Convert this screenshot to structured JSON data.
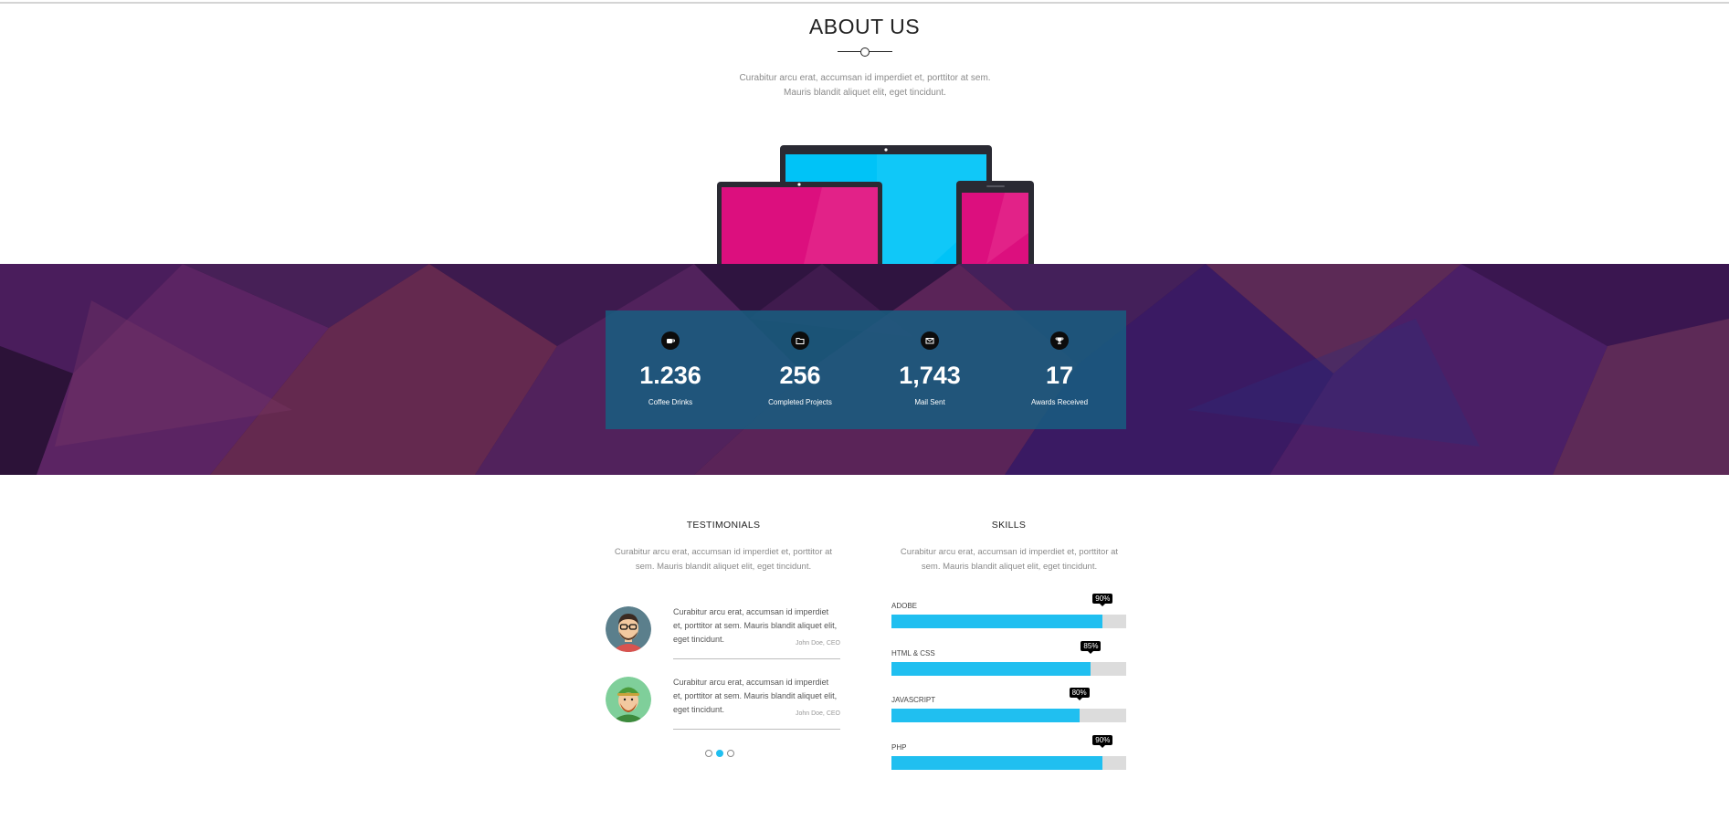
{
  "about": {
    "title": "ABOUT US",
    "text": "Curabitur arcu erat, accumsan id imperdiet et, porttitor at sem. Mauris blandit aliquet elit, eget tincidunt."
  },
  "stats": [
    {
      "icon": "coffee-icon",
      "value": "1.236",
      "label": "Coffee Drinks"
    },
    {
      "icon": "folder-icon",
      "value": "256",
      "label": "Completed Projects"
    },
    {
      "icon": "envelope-icon",
      "value": "1,743",
      "label": "Mail Sent"
    },
    {
      "icon": "trophy-icon",
      "value": "17",
      "label": "Awards Received"
    }
  ],
  "testimonials": {
    "title": "TESTIMONIALS",
    "text": "Curabitur arcu erat, accumsan id imperdiet et, porttitor at sem. Mauris blandit aliquet elit, eget tincidunt.",
    "items": [
      {
        "quote": "Curabitur arcu erat, accumsan id imperdiet et, porttitor at sem. Mauris blandit aliquet elit, eget tincidunt.",
        "author": "John Doe, CEO"
      },
      {
        "quote": "Curabitur arcu erat, accumsan id imperdiet et, porttitor at sem. Mauris blandit aliquet elit, eget tincidunt.",
        "author": "John Doe, CEO"
      }
    ],
    "pager": {
      "count": 3,
      "active": 2
    }
  },
  "skills": {
    "title": "SKILLS",
    "text": "Curabitur arcu erat, accumsan id imperdiet et, porttitor at sem. Mauris blandit aliquet elit, eget tincidunt.",
    "items": [
      {
        "name": "ADOBE",
        "percent": 90,
        "label": "90%"
      },
      {
        "name": "HTML & CSS",
        "percent": 85,
        "label": "85%"
      },
      {
        "name": "JAVASCRIPT",
        "percent": 80,
        "label": "80%"
      },
      {
        "name": "PHP",
        "percent": 90,
        "label": "90%"
      }
    ]
  },
  "colors": {
    "accent": "#20bff0",
    "stats_panel": "#185e80",
    "band_base": "#3a1747",
    "device_pink": "#dc0f7e",
    "device_cyan": "#00c3f7"
  }
}
